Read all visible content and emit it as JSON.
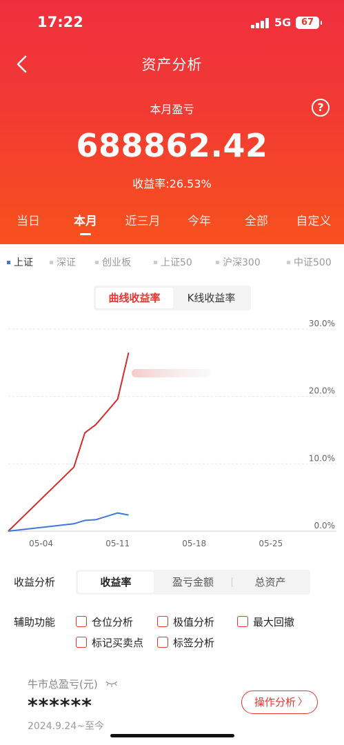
{
  "status_bar": {
    "time": "17:22",
    "network": "5G",
    "battery": "67"
  },
  "nav": {
    "title": "资产分析"
  },
  "summary": {
    "label": "本月盈亏",
    "value": "688862.42",
    "yield_text": "收益率:26.53%"
  },
  "periods": [
    {
      "label": "当日",
      "active": false
    },
    {
      "label": "本月",
      "active": true
    },
    {
      "label": "近三月",
      "active": false
    },
    {
      "label": "今年",
      "active": false
    },
    {
      "label": "全部",
      "active": false
    },
    {
      "label": "自定义",
      "active": false
    }
  ],
  "index_tabs": [
    {
      "label": "上证",
      "active": true
    },
    {
      "label": "深证",
      "active": false
    },
    {
      "label": "创业板",
      "active": false
    },
    {
      "label": "上证50",
      "active": false
    },
    {
      "label": "沪深300",
      "active": false
    },
    {
      "label": "中证500",
      "active": false
    }
  ],
  "chart_mode": {
    "curve": "曲线收益率",
    "kline": "K线收益率"
  },
  "chart_data": {
    "type": "line",
    "x_ticks": [
      "05-04",
      "05-11",
      "05-18",
      "05-25"
    ],
    "y_ticks": [
      "30.0%",
      "20.0%",
      "10.0%",
      "0.0%"
    ],
    "ylim": [
      0,
      30
    ],
    "xlim": [
      "05-01",
      "05-31"
    ],
    "series": [
      {
        "color": "#d42b2b",
        "points": [
          {
            "x": "05-01",
            "y": 0.0
          },
          {
            "x": "05-07",
            "y": 9.5
          },
          {
            "x": "05-08",
            "y": 14.6
          },
          {
            "x": "05-09",
            "y": 15.8
          },
          {
            "x": "05-11",
            "y": 19.6
          },
          {
            "x": "05-12",
            "y": 26.5
          }
        ]
      },
      {
        "color": "#3b78d8",
        "points": [
          {
            "x": "05-01",
            "y": 0.0
          },
          {
            "x": "05-07",
            "y": 1.1
          },
          {
            "x": "05-08",
            "y": 1.6
          },
          {
            "x": "05-09",
            "y": 1.7
          },
          {
            "x": "05-11",
            "y": 2.7
          },
          {
            "x": "05-12",
            "y": 2.4
          }
        ]
      }
    ],
    "grid": true
  },
  "analysis": {
    "label": "收益分析",
    "options": [
      {
        "label": "收益率",
        "active": true
      },
      {
        "label": "盈亏金额",
        "active": false
      },
      {
        "label": "总资产",
        "active": false
      }
    ]
  },
  "aux": {
    "label": "辅助功能",
    "checks": [
      "仓位分析",
      "极值分析",
      "最大回撤",
      "标记买卖点",
      "标签分析"
    ]
  },
  "bull": {
    "label": "牛市总盈亏(元)",
    "value": "******",
    "range": "2024.9.24~至今",
    "button": "操作分析"
  },
  "colors": {
    "brand_red": "#e8352f",
    "blue": "#3b78d8"
  }
}
